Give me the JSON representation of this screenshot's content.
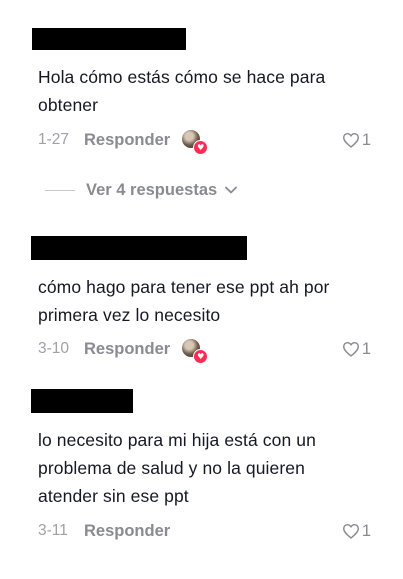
{
  "comments": [
    {
      "text": "Hola cómo estás cómo se hace para\nobtener",
      "date": "1-27",
      "reply_label": "Responder",
      "likes": "1",
      "has_creator_like": true
    },
    {
      "text": "cómo hago para tener ese ppt ah por\nprimera vez lo necesito",
      "date": "3-10",
      "reply_label": "Responder",
      "likes": "1",
      "has_creator_like": true
    },
    {
      "text": "lo necesito para mi hija está con un\nproblema de salud y no la quieren\natender sin ese ppt",
      "date": "3-11",
      "reply_label": "Responder",
      "likes": "1",
      "has_creator_like": false
    }
  ],
  "view_replies": {
    "label": "Ver 4 respuestas",
    "icon": "chevron-down-icon"
  },
  "icons": {
    "like": "heart-outline-icon",
    "creator_liked_badge": "heart-icon",
    "avatar": "avatar"
  },
  "colors": {
    "text": "#161823",
    "secondary": "#8a8b91",
    "date": "#a0a0a6",
    "accent": "#fe2c55",
    "redaction": "#000000"
  }
}
